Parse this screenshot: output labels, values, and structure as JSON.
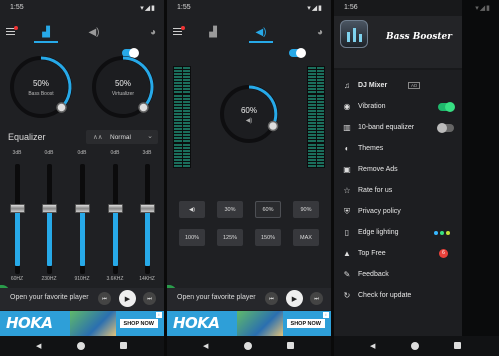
{
  "screens": [
    {
      "time": "1:55",
      "knobs": [
        {
          "value": "50%",
          "label": "Bass Boost"
        },
        {
          "value": "50%",
          "label": "Virtualizer"
        }
      ],
      "equalizer": {
        "title": "Equalizer",
        "preset": "Normal",
        "bands": [
          {
            "db": "3dB",
            "freq": "60HZ",
            "level": 0.5
          },
          {
            "db": "0dB",
            "freq": "230HZ",
            "level": 0.5
          },
          {
            "db": "0dB",
            "freq": "910HZ",
            "level": 0.5
          },
          {
            "db": "0dB",
            "freq": "3.6KHZ",
            "level": 0.5
          },
          {
            "db": "3dB",
            "freq": "14KHZ",
            "level": 0.5
          }
        ]
      },
      "player_text": "Open your favorite player"
    },
    {
      "time": "1:55",
      "volume": "60%",
      "presets_row1": [
        "",
        "30%",
        "60%",
        "90%"
      ],
      "presets_row2": [
        "100%",
        "125%",
        "150%",
        "MAX"
      ],
      "player_text": "Open your favorite player"
    },
    {
      "time": "1:56",
      "app_title": "Bass Booster",
      "menu": [
        {
          "icon": "dj-mixer-icon",
          "glyph": "♫",
          "label": "DJ Mixer",
          "badge": "AD"
        },
        {
          "icon": "vibration-icon",
          "glyph": "◉",
          "label": "Vibration",
          "toggle": "on"
        },
        {
          "icon": "equalizer-icon",
          "glyph": "▥",
          "label": "10-band equalizer",
          "toggle": "off"
        },
        {
          "icon": "themes-icon",
          "glyph": "◐",
          "label": "Themes"
        },
        {
          "icon": "remove-ads-icon",
          "glyph": "▣",
          "label": "Remove Ads"
        },
        {
          "icon": "rate-icon",
          "glyph": "☆",
          "label": "Rate for us"
        },
        {
          "icon": "privacy-icon",
          "glyph": "⛨",
          "label": "Privacy policy"
        },
        {
          "icon": "edge-lighting-icon",
          "glyph": "▯",
          "label": "Edge lighting"
        },
        {
          "icon": "top-free-icon",
          "glyph": "▲",
          "label": "Top Free",
          "badge": "6"
        },
        {
          "icon": "feedback-icon",
          "glyph": "✎",
          "label": "Feedback"
        },
        {
          "icon": "update-icon",
          "glyph": "↻",
          "label": "Check for update"
        }
      ]
    }
  ],
  "ad": {
    "brand": "HOKA",
    "cta": "SHOP NOW"
  },
  "colors": {
    "accent": "#27a9e8",
    "green": "#37e083",
    "background": "#1f2023"
  }
}
